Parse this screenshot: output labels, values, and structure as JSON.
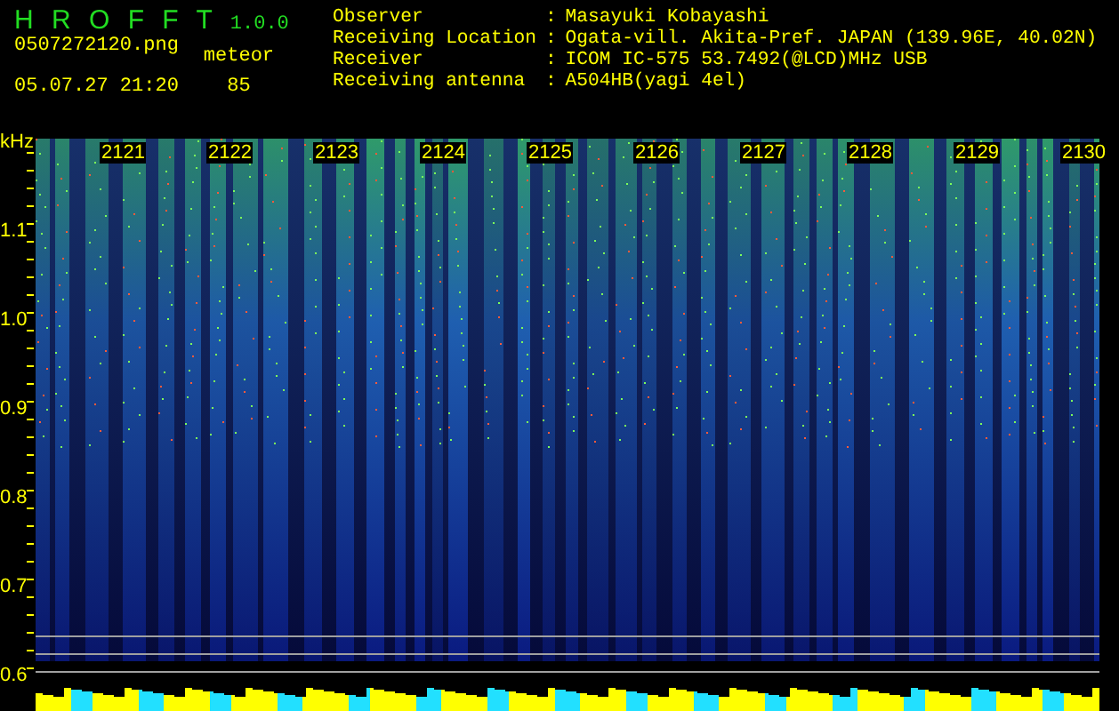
{
  "app": {
    "name": "H R O F F T",
    "version": "1.0.0"
  },
  "file": {
    "name": "0507272120.png",
    "datetime": "05.07.27 21:20"
  },
  "meteor": {
    "label": "meteor",
    "count": "85"
  },
  "info": [
    {
      "label": "Observer",
      "separator": ":",
      "value": "Masayuki Kobayashi"
    },
    {
      "label": "Receiving Location",
      "separator": ":",
      "value": "Ogata-vill. Akita-Pref. JAPAN (139.96E, 40.02N)"
    },
    {
      "label": "Receiver",
      "separator": ":",
      "value": "ICOM IC-575 53.7492(@LCD)MHz USB"
    },
    {
      "label": "Receiving antenna",
      "separator": ":",
      "value": "A504HB(yagi 4el)"
    }
  ],
  "spectrogram": {
    "unit": "kHz",
    "frequency_labels": [
      "1.1",
      "1.0",
      "0.9",
      "0.8",
      "0.7",
      "0.6"
    ],
    "time_labels": [
      "2121",
      "2122",
      "2123",
      "2124",
      "2125",
      "2126",
      "2127",
      "2128",
      "2129",
      "2130"
    ]
  }
}
